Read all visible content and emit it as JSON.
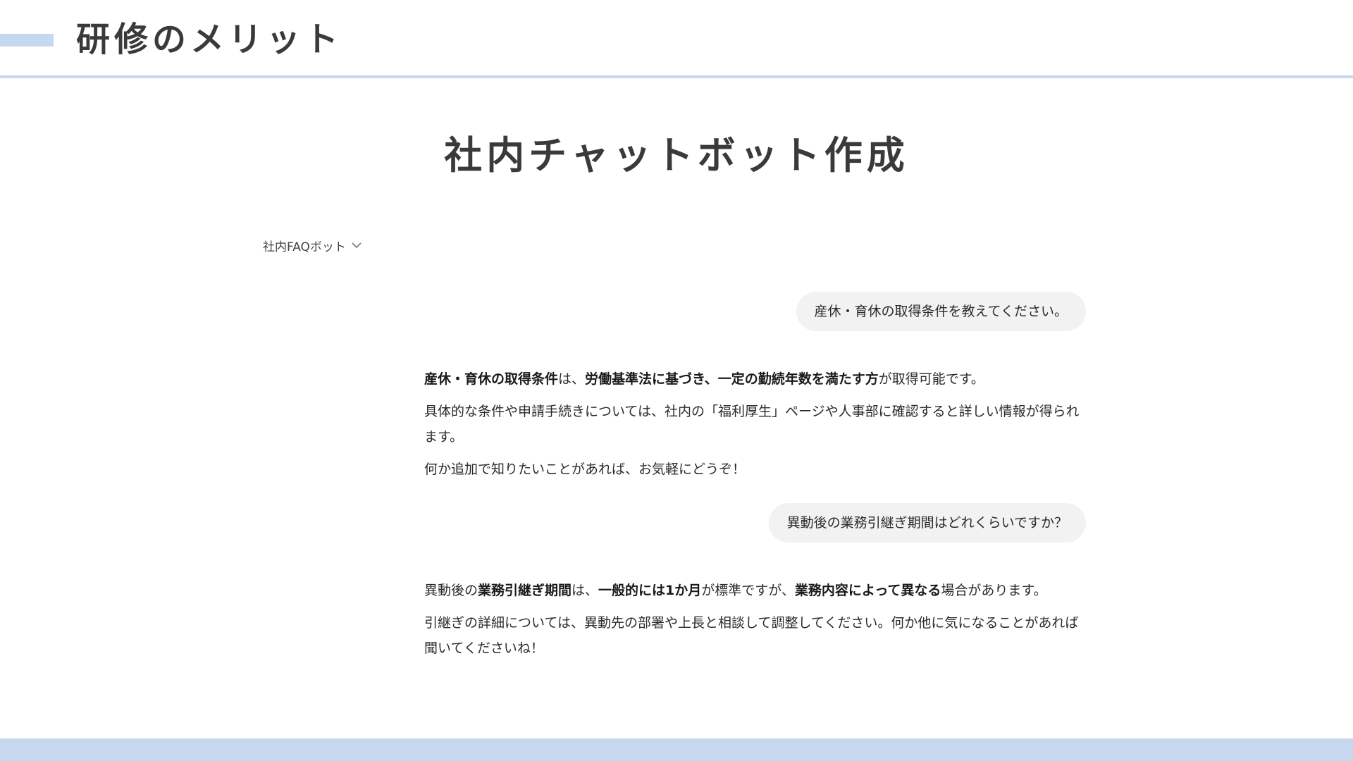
{
  "header": {
    "title": "研修のメリット"
  },
  "main": {
    "title": "社内チャットボット作成"
  },
  "bot_selector": {
    "label": "社内FAQボット",
    "icon": "chevron-down-icon"
  },
  "conversation": [
    {
      "role": "user",
      "text": "産休・育休の取得条件を教えてください。"
    },
    {
      "role": "bot",
      "line1": {
        "b1": "産休・育休の取得条件",
        "t1": "は、",
        "b2": "労働基準法に基づき、一定の勤続年数を満たす方",
        "t2": "が取得可能です。"
      },
      "line2": "具体的な条件や申請手続きについては、社内の「福利厚生」ページや人事部に確認すると詳しい情報が得られます。",
      "line3": "何か追加で知りたいことがあれば、お気軽にどうぞ！"
    },
    {
      "role": "user",
      "text": "異動後の業務引継ぎ期間はどれくらいですか？"
    },
    {
      "role": "bot",
      "line1": {
        "t0": "異動後の",
        "b1": "業務引継ぎ期間",
        "t1": "は、",
        "b2": "一般的には1か月",
        "t2": "が標準ですが、",
        "b3": "業務内容によって異なる",
        "t3": "場合があります。"
      },
      "line2": "引継ぎの詳細については、異動先の部署や上長と相談して調整してください。何か他に気になることがあれば聞いてくださいね！"
    }
  ],
  "colors": {
    "accent": "#c5d8f0",
    "bubble": "#f2f2f2",
    "text": "#2b2b2b",
    "heading": "#3a3a3a"
  }
}
